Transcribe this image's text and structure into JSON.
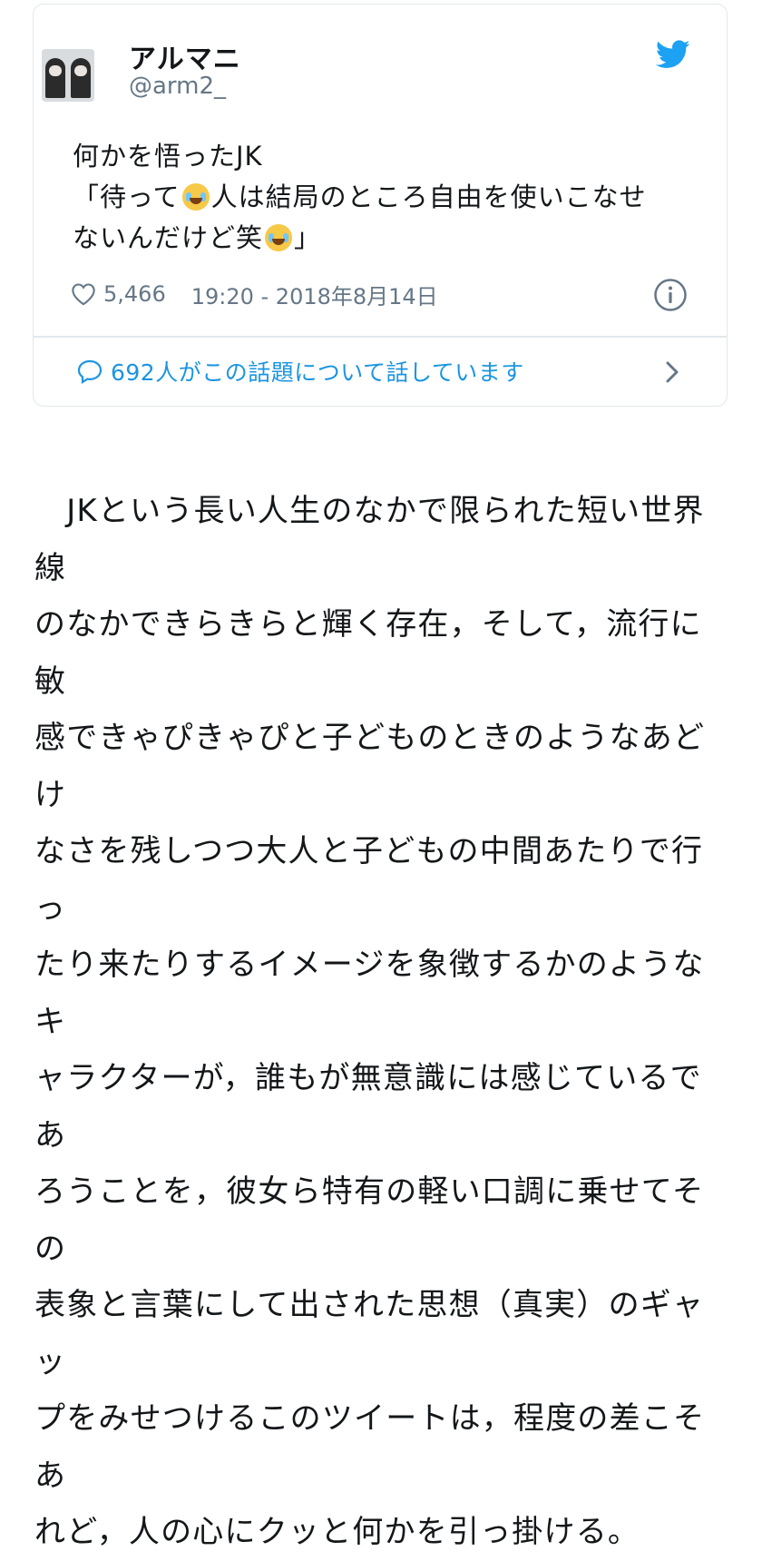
{
  "tweet": {
    "display_name": "アルマニ",
    "handle": "@arm2_",
    "text_lines": [
      "何かを悟ったJK",
      "「待って",
      "人は結局のところ自由を使いこなせ",
      "ないんだけど笑",
      "」"
    ],
    "emoji_1": "face-with-tears-of-joy",
    "emoji_2": "rolling-on-the-floor-laughing",
    "like_count": "5,466",
    "timestamp": "19:20 - 2018年8月14日",
    "conversation_text": "692人がこの話題について話しています",
    "accent_color": "#1b95e0"
  },
  "article": {
    "lines": [
      "　JKという長い人生のなかで限られた短い世界線",
      "のなかできらきらと輝く存在，そして，流行に敏",
      "感できゃぴきゃぴと子どものときのようなあどけ",
      "なさを残しつつ大人と子どもの中間あたりで行っ",
      "たり来たりするイメージを象徴するかのようなキ",
      "ャラクターが，誰もが無意識には感じているであ",
      "ろうことを，彼女ら特有の軽い口調に乗せてその",
      "表象と言葉にして出された思想（真実）のギャッ",
      "プをみせつけるこのツイートは，程度の差こそあ",
      "れど，人の心にクッと何かを引っ掛ける。"
    ]
  }
}
